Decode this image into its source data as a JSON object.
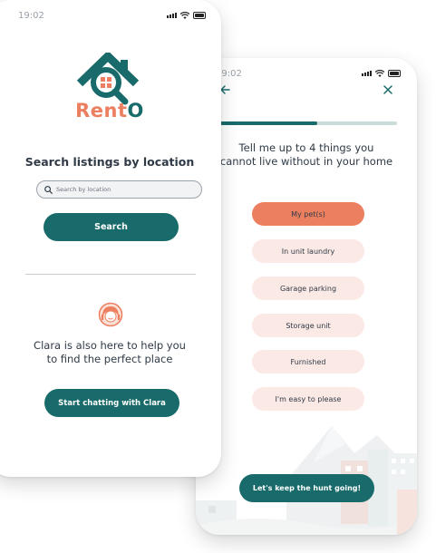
{
  "colors": {
    "teal": "#186b6a",
    "coral": "#ec7f5f",
    "chip_bg": "#fbe9e5",
    "text": "#2f3a46"
  },
  "left_screen": {
    "status_time": "19:02",
    "logo": {
      "part1": "Rent",
      "part2": "O",
      "icon": "house-magnifier-icon"
    },
    "heading": "Search listings by location",
    "search": {
      "placeholder": "Search by location",
      "value": "",
      "icon": "search-icon"
    },
    "search_button": "Search",
    "assistant": {
      "icon": "assistant-avatar-icon",
      "text_line1": "Clara is also here to help you",
      "text_line2": "to find the perfect place",
      "button": "Start chatting with Clara"
    }
  },
  "right_screen": {
    "status_time": "19:02",
    "back_icon": "arrow-left-icon",
    "close_icon": "close-icon",
    "progress": 0.55,
    "title_line1": "Tell me up to 4 things you",
    "title_line2": "cannot live without in your home",
    "options": [
      {
        "label": "My pet(s)",
        "selected": true
      },
      {
        "label": "In unit laundry",
        "selected": false
      },
      {
        "label": "Garage parking",
        "selected": false
      },
      {
        "label": "Storage unit",
        "selected": false
      },
      {
        "label": "Furnished",
        "selected": false
      },
      {
        "label": "I'm easy to please",
        "selected": false
      }
    ],
    "cta_button": "Let's keep the hunt going!"
  }
}
